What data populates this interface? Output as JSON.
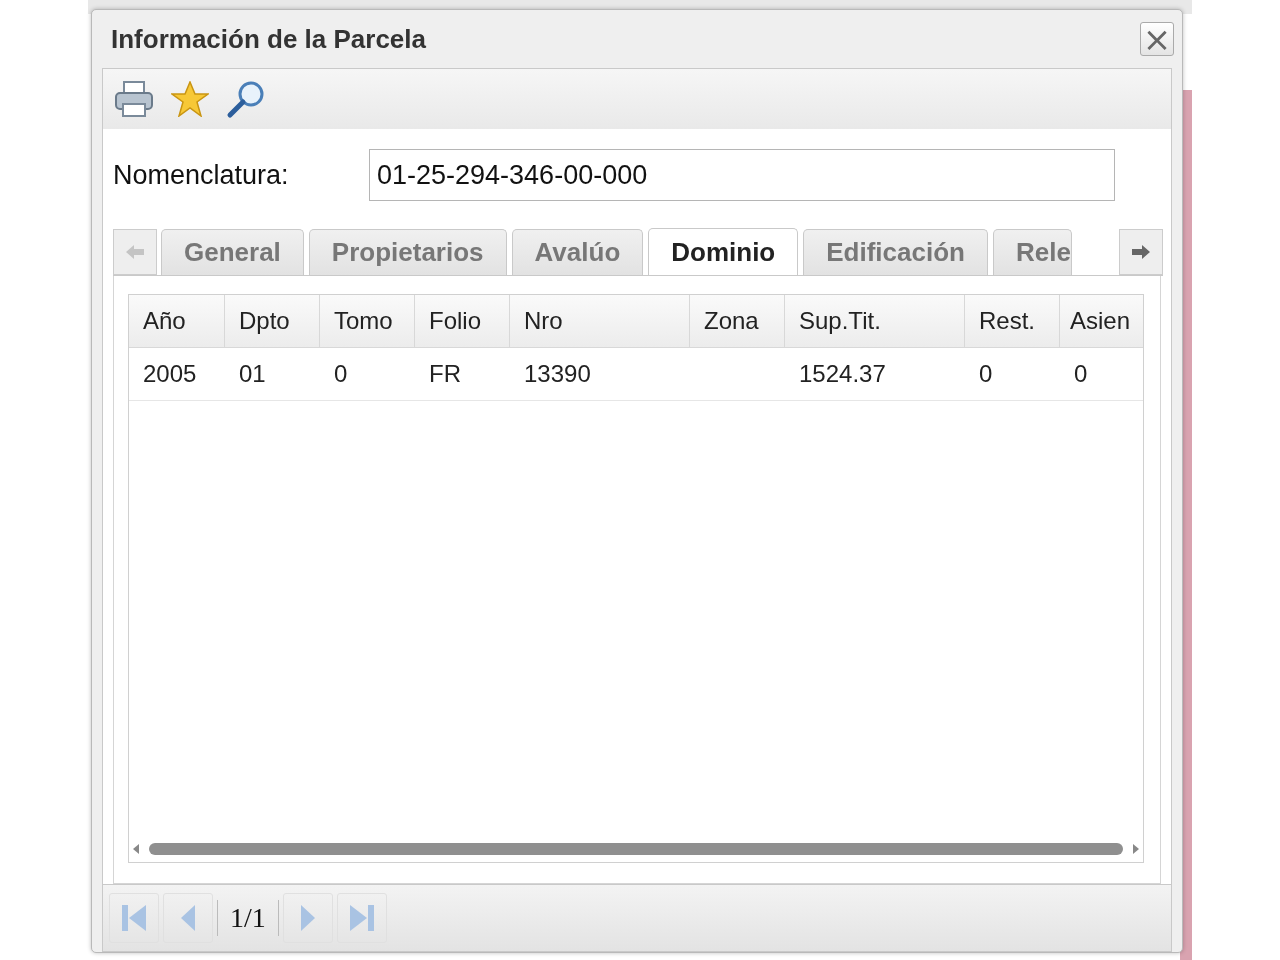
{
  "window": {
    "title": "Información de la Parcela",
    "close": "×"
  },
  "field": {
    "label": "Nomenclatura:",
    "value": "01-25-294-346-00-000"
  },
  "tabs": [
    {
      "label": "General",
      "selected": false
    },
    {
      "label": "Propietarios",
      "selected": false
    },
    {
      "label": "Avalúo",
      "selected": false
    },
    {
      "label": "Dominio",
      "selected": true
    },
    {
      "label": "Edificación",
      "selected": false
    },
    {
      "label": "Rele",
      "selected": false
    }
  ],
  "table": {
    "columns": [
      "Año",
      "Dpto",
      "Tomo",
      "Folio",
      "Nro",
      "Zona",
      "Sup.Tit.",
      "Rest.",
      "Asien"
    ],
    "rows": [
      [
        "2005",
        "01",
        "0",
        "FR",
        "13390",
        "",
        "1524.37",
        "0",
        "0"
      ]
    ]
  },
  "pager": {
    "page": "1/1"
  }
}
